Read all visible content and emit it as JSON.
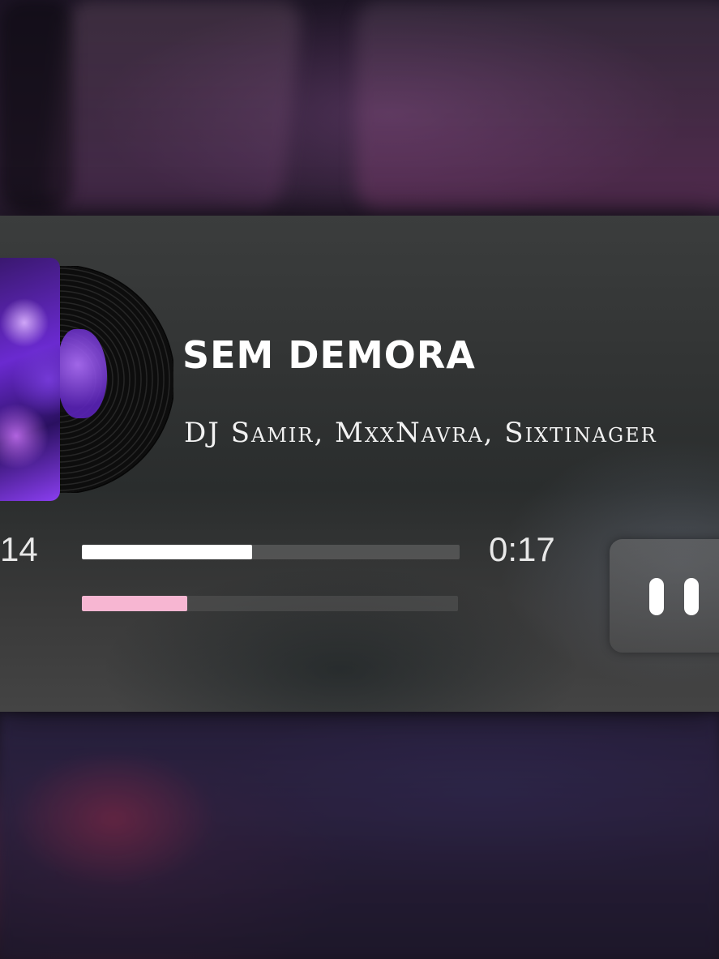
{
  "player": {
    "title": "SEM DEMORA",
    "artists": "DJ Samir, MxxNavra, Sixtinager",
    "time_elapsed": "14",
    "time_total": "0:17",
    "progress_fraction": 0.45,
    "secondary_fraction": 0.28,
    "controls": {
      "pause_icon": "pause-icon"
    }
  },
  "colors": {
    "progress_fill": "#ffffff",
    "secondary_fill": "#f7b6d2",
    "card_background": "#333535"
  }
}
